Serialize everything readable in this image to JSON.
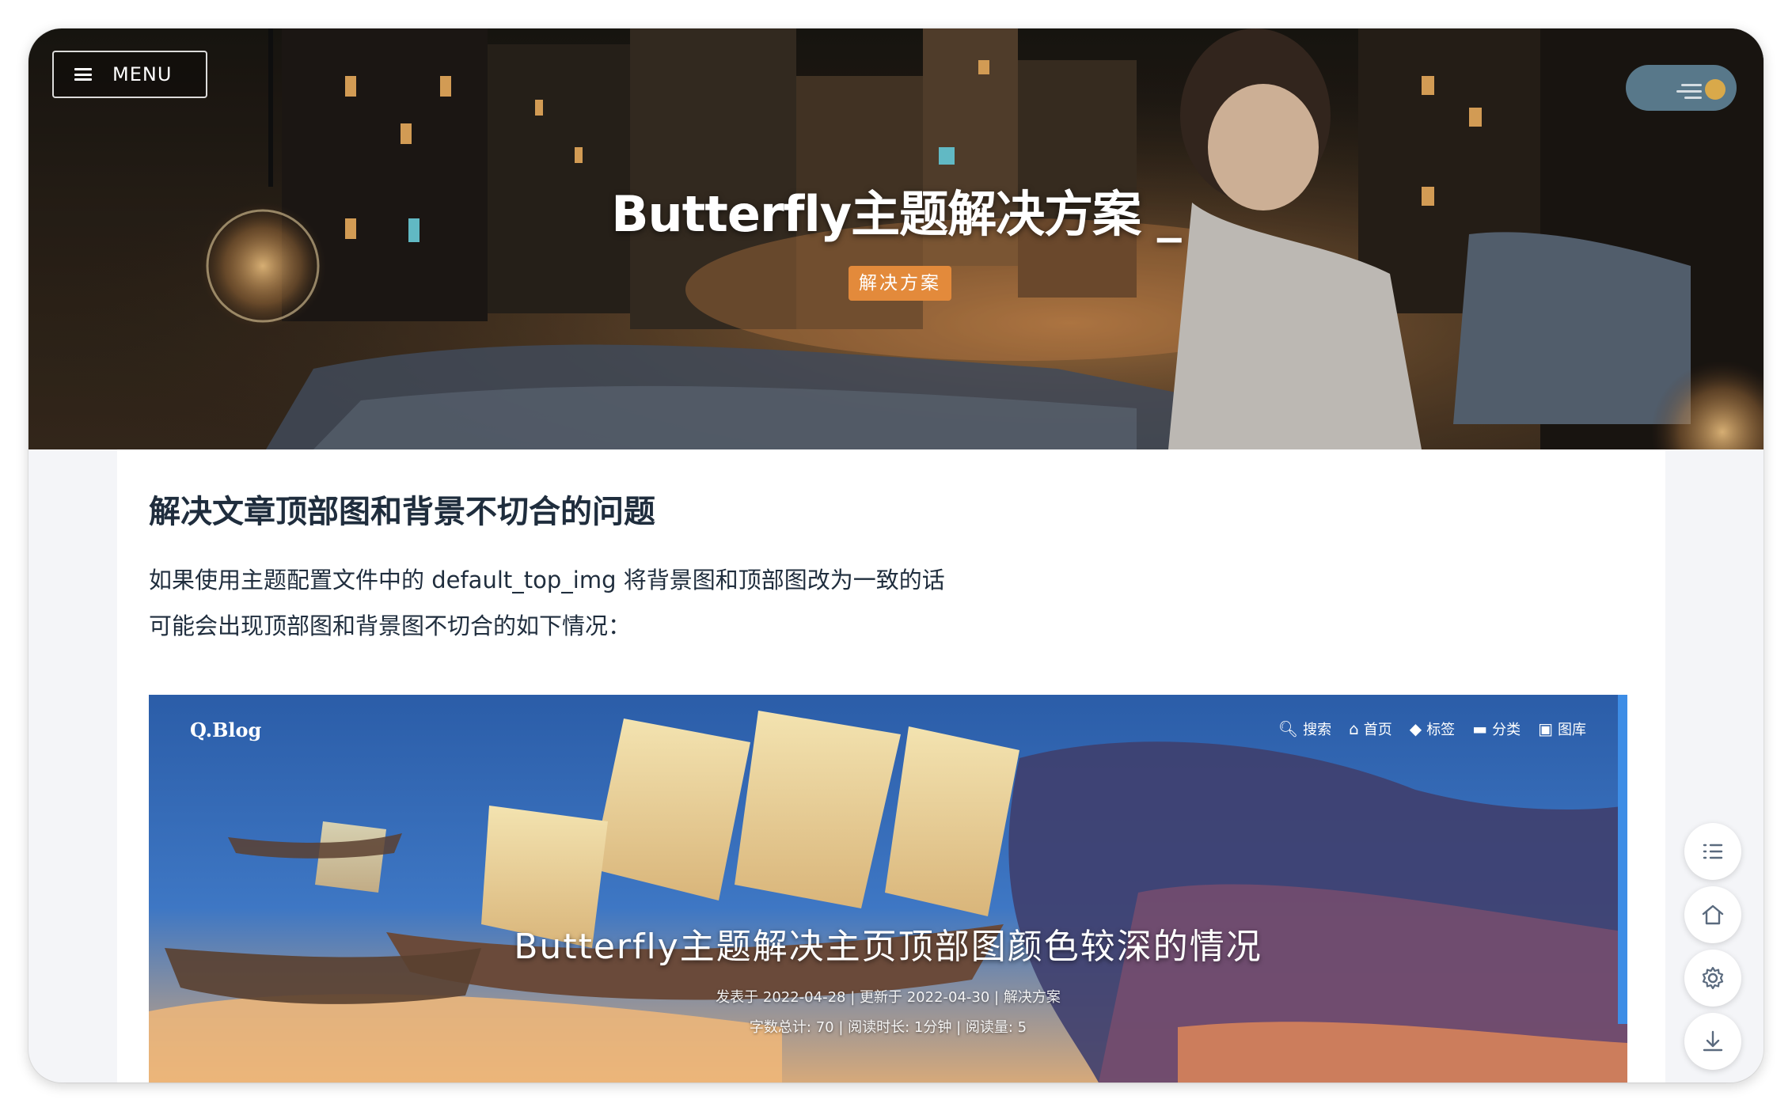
{
  "header": {
    "menu_label": "MENU",
    "title": "Butterfly主题解决方案 _",
    "tag": "解决方案"
  },
  "article": {
    "heading": "解决文章顶部图和背景不切合的问题",
    "line1": "如果使用主题配置文件中的 default_top_img 将背景图和顶部图改为一致的话",
    "line2": "可能会出现顶部图和背景图不切合的如下情况："
  },
  "screenshot": {
    "logo": "Q.Blog",
    "nav": [
      {
        "icon": "search-icon",
        "label": "搜索"
      },
      {
        "icon": "home-icon",
        "label": "首页"
      },
      {
        "icon": "tag-icon",
        "label": "标签"
      },
      {
        "icon": "folder-icon",
        "label": "分类"
      },
      {
        "icon": "image-icon",
        "label": "图库"
      }
    ],
    "title": "Butterfly主题解决主页顶部图颜色较深的情况",
    "meta1": "发表于 2022-04-28 | 更新于 2022-04-30 | 解决方案",
    "meta2": "字数总计: 70 | 阅读时长: 1分钟 | 阅读量: 5"
  },
  "rightside": {
    "buttons": [
      "toc-icon",
      "home-icon",
      "gear-icon",
      "download-icon"
    ]
  },
  "colors": {
    "tag_bg": "#e38a3b",
    "toggle_bg": "#58788a",
    "accent_bar": "#3d8de6"
  }
}
